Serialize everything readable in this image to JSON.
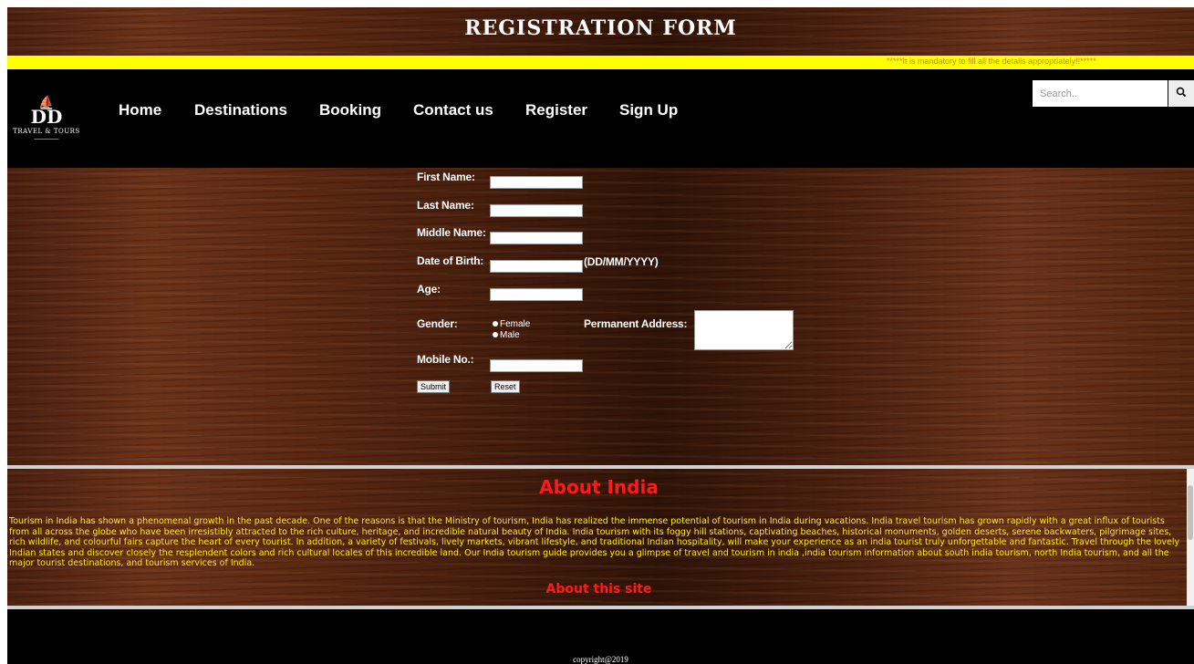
{
  "header": {
    "title": "REGISTRATION FORM"
  },
  "marquee": {
    "text": "*****It is mandatory to fill all the details appropriately!!*****"
  },
  "nav": {
    "logo": {
      "mark": "DD",
      "brand": "TRAVEL & TOURS"
    },
    "items": [
      "Home",
      "Destinations",
      "Booking",
      "Contact us",
      "Register",
      "Sign Up"
    ],
    "search_placeholder": "Search..",
    "search_icon": "magnifier-icon"
  },
  "form": {
    "first_name_label": "First Name:",
    "last_name_label": "Last Name:",
    "middle_name_label": "Middle Name:",
    "dob_label": "Date of Birth:",
    "dob_hint": "(DD/MM/YYYY)",
    "age_label": "Age:",
    "gender_label": "Gender:",
    "gender_options": [
      "Female",
      "Male"
    ],
    "address_label": "Permanent Address:",
    "mobile_label": "Mobile No.:",
    "submit_label": "Submit",
    "reset_label": "Reset"
  },
  "about": {
    "heading": "About India",
    "text": "Tourism in India has shown a phenomenal growth in the past decade. One of the reasons is that the Ministry of tourism, India has realized the immense potential of tourism in India during vacations. India travel tourism has grown rapidly with a great influx of tourists from all across the globe who have been irresistibly attracted to the rich culture, heritage, and incredible natural beauty of India. India tourism with its foggy hill stations, captivating beaches, historical monuments, golden deserts, serene backwaters, pilgrimage sites, rich wildlife, and colourful fairs capture the heart of every tourist. In addition, a variety of festivals, lively markets, vibrant lifestyle, and traditional Indian hospitality, will make your experience as an india tourist truly unforgettable and fantastic. Travel through the lovely Indian states and discover closely the resplendent colors and rich cultural locales of this incredible land. Our India tourism guide provides you a glimpse of travel and tourism in india ,india tourism information about south india tourism, north India tourism, and all the major tourist destinations, and tourism services of India.",
    "subheading": "About this site"
  },
  "footer": {
    "text": "copyright@2019"
  },
  "colors": {
    "accent_yellow": "#ffff00",
    "heading_red": "#ff1a1a",
    "body_text_yellow": "#ffee00",
    "nav_bg": "#000000"
  }
}
